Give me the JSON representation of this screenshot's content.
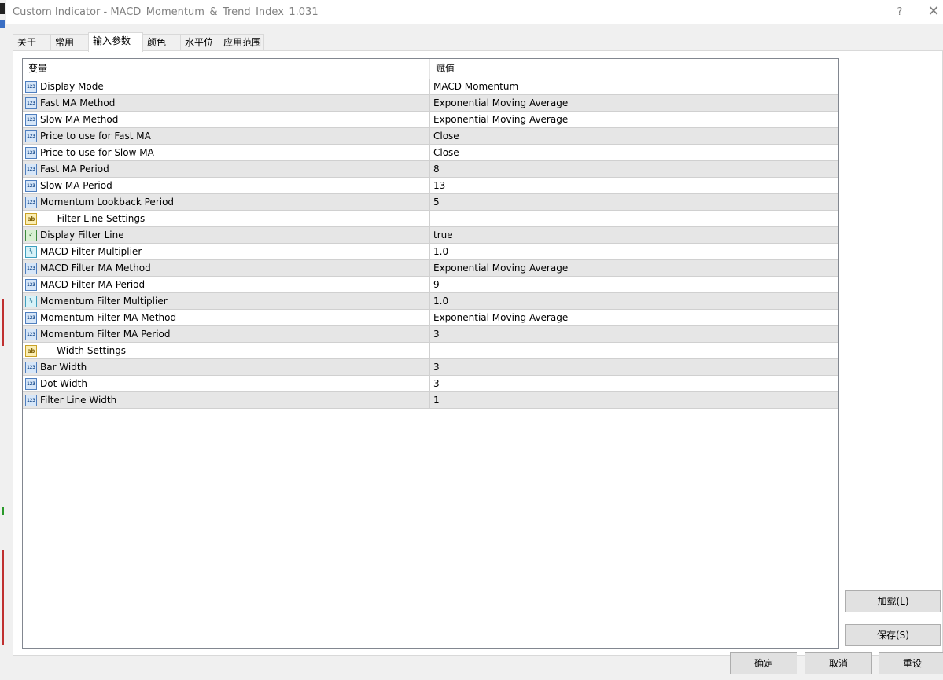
{
  "window": {
    "title": "Custom Indicator - MACD_Momentum_&_Trend_Index_1.031",
    "help_label": "?",
    "close_label": "✕"
  },
  "tabs": [
    {
      "label": "关于",
      "active": false
    },
    {
      "label": "常用",
      "active": false
    },
    {
      "label": "输入参数",
      "active": true
    },
    {
      "label": "颜色",
      "active": false
    },
    {
      "label": "水平位",
      "active": false
    },
    {
      "label": "应用范围",
      "active": false
    }
  ],
  "grid": {
    "columns": [
      "变量",
      "赋值"
    ],
    "rows": [
      {
        "icon": "123",
        "type": "int-icon",
        "name": "Display Mode",
        "value": "MACD Momentum"
      },
      {
        "icon": "123",
        "type": "int-icon",
        "name": "Fast MA Method",
        "value": "Exponential Moving Average"
      },
      {
        "icon": "123",
        "type": "int-icon",
        "name": "Slow MA Method",
        "value": "Exponential Moving Average"
      },
      {
        "icon": "123",
        "type": "int-icon",
        "name": "Price to use for Fast MA",
        "value": "Close"
      },
      {
        "icon": "123",
        "type": "int-icon",
        "name": "Price to use for Slow MA",
        "value": "Close"
      },
      {
        "icon": "123",
        "type": "int-icon",
        "name": "Fast MA Period",
        "value": "8"
      },
      {
        "icon": "123",
        "type": "int-icon",
        "name": "Slow MA Period",
        "value": "13"
      },
      {
        "icon": "123",
        "type": "int-icon",
        "name": "Momentum Lookback Period",
        "value": "5"
      },
      {
        "icon": "ab",
        "type": "string-icon",
        "name": "-----Filter Line Settings-----",
        "value": "-----"
      },
      {
        "icon": "✓",
        "type": "bool-icon",
        "name": "Display Filter Line",
        "value": "true"
      },
      {
        "icon": "½",
        "type": "double-icon",
        "name": "MACD Filter Multiplier",
        "value": "1.0"
      },
      {
        "icon": "123",
        "type": "int-icon",
        "name": "MACD Filter MA Method",
        "value": "Exponential Moving Average"
      },
      {
        "icon": "123",
        "type": "int-icon",
        "name": "MACD Filter MA Period",
        "value": "9"
      },
      {
        "icon": "½",
        "type": "double-icon",
        "name": "Momentum Filter Multiplier",
        "value": "1.0"
      },
      {
        "icon": "123",
        "type": "int-icon",
        "name": "Momentum Filter MA Method",
        "value": "Exponential Moving Average"
      },
      {
        "icon": "123",
        "type": "int-icon",
        "name": "Momentum Filter MA Period",
        "value": "3"
      },
      {
        "icon": "ab",
        "type": "string-icon",
        "name": "-----Width Settings-----",
        "value": "-----"
      },
      {
        "icon": "123",
        "type": "int-icon",
        "name": "Bar Width",
        "value": "3"
      },
      {
        "icon": "123",
        "type": "int-icon",
        "name": "Dot Width",
        "value": "3"
      },
      {
        "icon": "123",
        "type": "int-icon",
        "name": "Filter Line Width",
        "value": "1"
      }
    ]
  },
  "side_buttons": {
    "load": "加载(L)",
    "save": "保存(S)"
  },
  "bottom_buttons": {
    "ok": "确定",
    "cancel": "取消",
    "reset": "重设"
  }
}
